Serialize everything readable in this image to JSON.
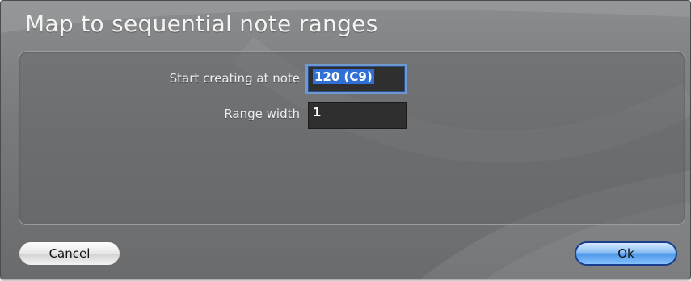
{
  "dialog": {
    "title": "Map to sequential note ranges"
  },
  "form": {
    "start_label": "Start creating at note",
    "start_value": "120 (C9)",
    "range_label": "Range width",
    "range_value": "1"
  },
  "buttons": {
    "cancel_label": "Cancel",
    "ok_label": "Ok"
  },
  "colors": {
    "accent": "#4e98e8",
    "focus_ring": "#6e98cf",
    "selection": "#2f6fd6"
  }
}
